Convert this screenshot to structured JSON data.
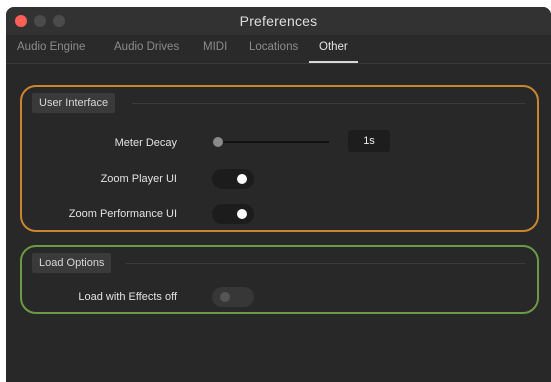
{
  "window": {
    "title": "Preferences"
  },
  "tabs": [
    {
      "label": "Audio Engine",
      "active": false
    },
    {
      "label": "Audio Drives",
      "active": false
    },
    {
      "label": "MIDI",
      "active": false
    },
    {
      "label": "Locations",
      "active": false
    },
    {
      "label": "Other",
      "active": true
    }
  ],
  "user_interface": {
    "header": "User Interface",
    "accent_color": "#c9862c",
    "meter_decay": {
      "label": "Meter Decay",
      "value": "1s",
      "slider_level": 0.0
    },
    "zoom_player_ui": {
      "label": "Zoom Player UI",
      "on": true
    },
    "zoom_performance_ui": {
      "label": "Zoom Performance UI",
      "on": true
    }
  },
  "load_options": {
    "header": "Load Options",
    "accent_color": "#6a9a45",
    "load_with_effects_off": {
      "label": "Load with Effects off",
      "on": false
    }
  },
  "icons": {
    "close": "close-dot-icon",
    "minimize": "minimize-dot-icon",
    "maximize": "maximize-dot-icon"
  }
}
